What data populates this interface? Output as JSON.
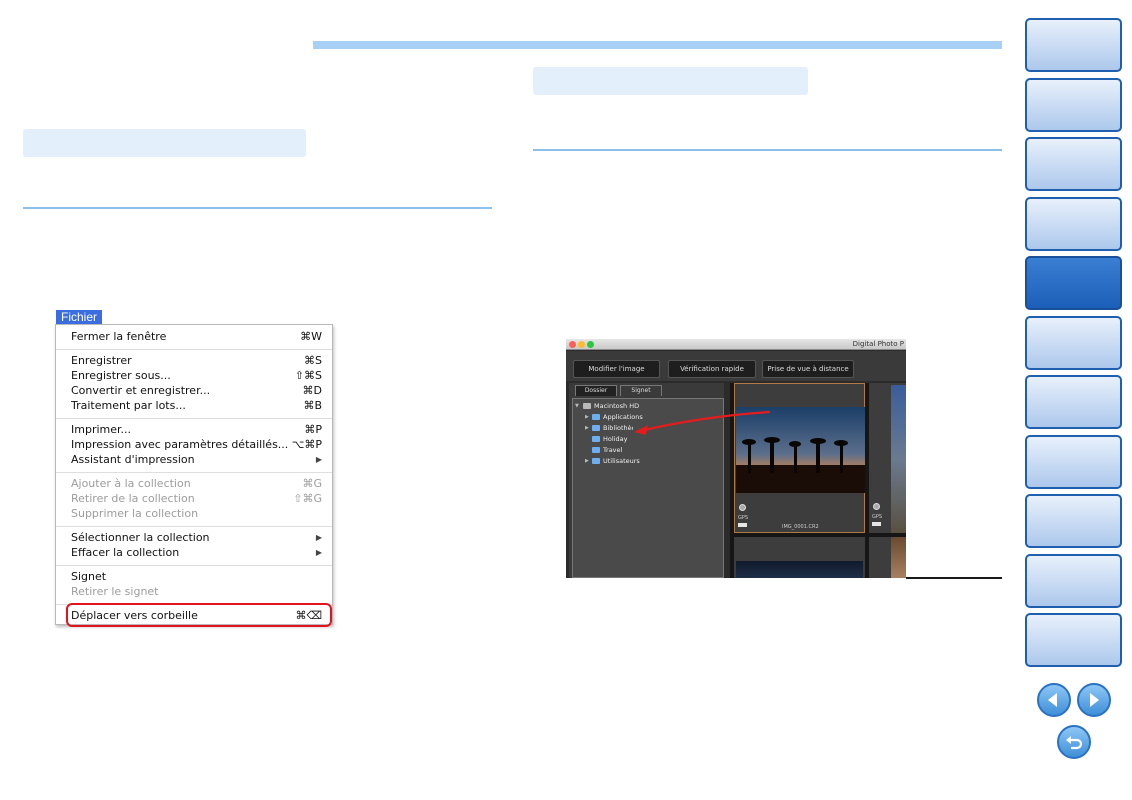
{
  "menu": {
    "title": "Fichier",
    "items": [
      {
        "label": "Fermer la fenêtre",
        "shortcut": "⌘W",
        "enabled": true
      },
      {
        "label": "Enregistrer",
        "shortcut": "⌘S",
        "enabled": true
      },
      {
        "label": "Enregistrer sous...",
        "shortcut": "⇧⌘S",
        "enabled": true
      },
      {
        "label": "Convertir et enregistrer...",
        "shortcut": "⌘D",
        "enabled": true
      },
      {
        "label": "Traitement par lots...",
        "shortcut": "⌘B",
        "enabled": true
      },
      {
        "label": "Imprimer...",
        "shortcut": "⌘P",
        "enabled": true
      },
      {
        "label": "Impression avec paramètres détaillés...",
        "shortcut": "⌥⌘P",
        "enabled": true
      },
      {
        "label": "Assistant d'impression",
        "shortcut": "▶",
        "enabled": true
      },
      {
        "label": "Ajouter à la collection",
        "shortcut": "⌘G",
        "enabled": false
      },
      {
        "label": "Retirer de la collection",
        "shortcut": "⇧⌘G",
        "enabled": false
      },
      {
        "label": "Supprimer la collection",
        "shortcut": "",
        "enabled": false
      },
      {
        "label": "Sélectionner la collection",
        "shortcut": "▶",
        "enabled": true
      },
      {
        "label": "Effacer la collection",
        "shortcut": "▶",
        "enabled": true
      },
      {
        "label": "Signet",
        "shortcut": "",
        "enabled": true
      },
      {
        "label": "Retirer le signet",
        "shortcut": "",
        "enabled": false
      },
      {
        "label": "Déplacer vers corbeille",
        "shortcut": "⌘⌫",
        "enabled": true
      }
    ]
  },
  "dpp": {
    "window_title": "Digital Photo P",
    "buttons": [
      "Modifier l'image",
      "Vérification rapide",
      "Prise de vue à distance"
    ],
    "side_tabs": [
      "Dossier",
      "Signet"
    ],
    "tree": {
      "root": "Macintosh HD",
      "children": [
        "Applications",
        "Bibliothèque",
        "Holiday",
        "Travel",
        "Utilisateurs"
      ]
    },
    "thumbnails": [
      {
        "filename": "IMG_0001.CR2",
        "gps_label": "GPS"
      },
      {
        "filename": "",
        "gps_label": "GPS"
      }
    ]
  },
  "colors": {
    "accent_rule": "#8cc0ec",
    "highlight": "#e2121f",
    "nav_tab": "#1f5fb0",
    "nav_tab_active": "#1b5fb8"
  },
  "icons": {
    "prev": "chevron-left-icon",
    "next": "chevron-right-icon",
    "back": "return-arrow-icon"
  }
}
